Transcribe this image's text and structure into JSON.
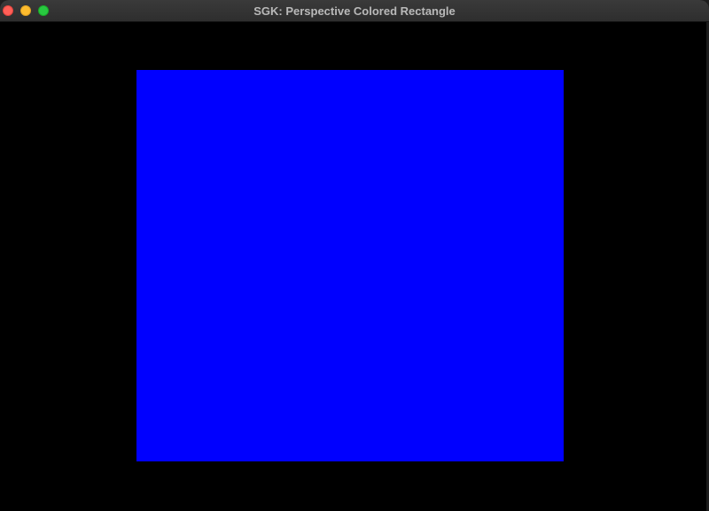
{
  "window": {
    "title": "SGK: Perspective Colored Rectangle",
    "traffic_lights": {
      "close_color": "#ff5f57",
      "minimize_color": "#febc2e",
      "zoom_color": "#28c840"
    }
  },
  "scene": {
    "background_color": "#000000",
    "rectangle_color": "#0000ff"
  }
}
